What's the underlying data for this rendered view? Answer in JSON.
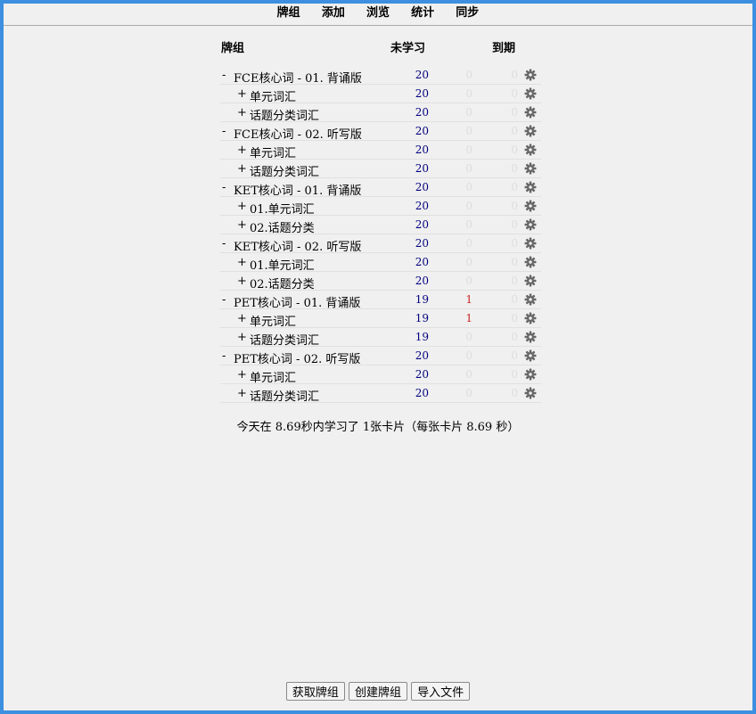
{
  "nav": {
    "decks": "牌组",
    "add": "添加",
    "browse": "浏览",
    "stats": "统计",
    "sync": "同步"
  },
  "table": {
    "col_deck": "牌组",
    "col_new": "未学习",
    "col_due": "到期"
  },
  "decks": [
    {
      "level": "top",
      "toggle": "-",
      "name": "FCE核心词 - 01. 背诵版",
      "new": "20",
      "learn": "0",
      "due": "0"
    },
    {
      "level": "child",
      "toggle": "+",
      "name": "单元词汇",
      "new": "20",
      "learn": "0",
      "due": "0"
    },
    {
      "level": "child",
      "toggle": "+",
      "name": "话题分类词汇",
      "new": "20",
      "learn": "0",
      "due": "0"
    },
    {
      "level": "top",
      "toggle": "-",
      "name": "FCE核心词 - 02. 听写版",
      "new": "20",
      "learn": "0",
      "due": "0"
    },
    {
      "level": "child",
      "toggle": "+",
      "name": "单元词汇",
      "new": "20",
      "learn": "0",
      "due": "0"
    },
    {
      "level": "child",
      "toggle": "+",
      "name": "话题分类词汇",
      "new": "20",
      "learn": "0",
      "due": "0"
    },
    {
      "level": "top",
      "toggle": "-",
      "name": "KET核心词 - 01. 背诵版",
      "new": "20",
      "learn": "0",
      "due": "0"
    },
    {
      "level": "child",
      "toggle": "+",
      "name": "01.单元词汇",
      "new": "20",
      "learn": "0",
      "due": "0"
    },
    {
      "level": "child",
      "toggle": "+",
      "name": "02.话题分类",
      "new": "20",
      "learn": "0",
      "due": "0"
    },
    {
      "level": "top",
      "toggle": "-",
      "name": "KET核心词 - 02. 听写版",
      "new": "20",
      "learn": "0",
      "due": "0"
    },
    {
      "level": "child",
      "toggle": "+",
      "name": "01.单元词汇",
      "new": "20",
      "learn": "0",
      "due": "0"
    },
    {
      "level": "child",
      "toggle": "+",
      "name": "02.话题分类",
      "new": "20",
      "learn": "0",
      "due": "0"
    },
    {
      "level": "top",
      "toggle": "-",
      "name": "PET核心词 - 01. 背诵版",
      "new": "19",
      "learn": "1",
      "due": "0"
    },
    {
      "level": "child",
      "toggle": "+",
      "name": "单元词汇",
      "new": "19",
      "learn": "1",
      "due": "0"
    },
    {
      "level": "child",
      "toggle": "+",
      "name": "话题分类词汇",
      "new": "19",
      "learn": "0",
      "due": "0"
    },
    {
      "level": "top",
      "toggle": "-",
      "name": "PET核心词 - 02. 听写版",
      "new": "20",
      "learn": "0",
      "due": "0"
    },
    {
      "level": "child",
      "toggle": "+",
      "name": "单元词汇",
      "new": "20",
      "learn": "0",
      "due": "0"
    },
    {
      "level": "child",
      "toggle": "+",
      "name": "话题分类词汇",
      "new": "20",
      "learn": "0",
      "due": "0"
    }
  ],
  "summary": "今天在 8.69秒内学习了 1张卡片（每张卡片 8.69 秒）",
  "buttons": {
    "get_shared": "获取牌组",
    "create_deck": "创建牌组",
    "import_file": "导入文件"
  },
  "colors": {
    "new_count": "#000080",
    "learn_count": "#cc2222",
    "zero_count": "#dddddd",
    "window_border": "#3d8fe0"
  },
  "icons": {
    "deck_options": "gear-icon"
  }
}
